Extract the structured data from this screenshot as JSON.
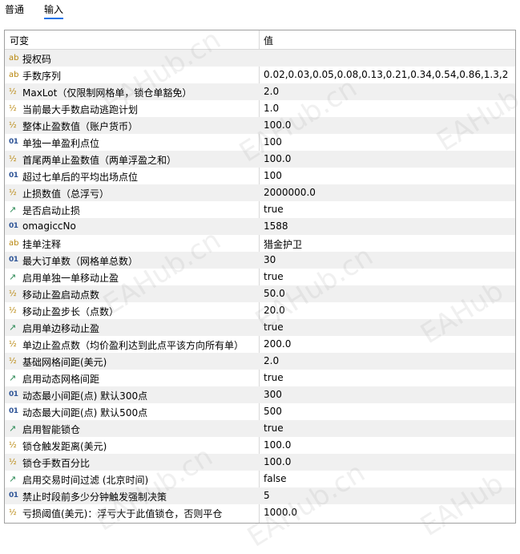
{
  "tabs": [
    {
      "label": "普通",
      "active": false
    },
    {
      "label": "输入",
      "active": true
    }
  ],
  "columns": {
    "variable": "可变",
    "value": "值"
  },
  "rows": [
    {
      "type": "string",
      "icon": "ab",
      "name": "授权码",
      "value": ""
    },
    {
      "type": "string",
      "icon": "ab",
      "name": "手数序列",
      "value": "0.02,0.03,0.05,0.08,0.13,0.21,0.34,0.54,0.86,1.3,2"
    },
    {
      "type": "double",
      "icon": "½",
      "name": "MaxLot（仅限制网格单，锁仓单豁免）",
      "value": "2.0"
    },
    {
      "type": "double",
      "icon": "½",
      "name": "当前最大手数启动逃跑计划",
      "value": "1.0"
    },
    {
      "type": "double",
      "icon": "½",
      "name": "整体止盈数值（账户货币）",
      "value": "100.0"
    },
    {
      "type": "int",
      "icon": "01",
      "name": "单独一单盈利点位",
      "value": "100"
    },
    {
      "type": "double",
      "icon": "½",
      "name": "首尾两单止盈数值（两单浮盈之和）",
      "value": "100.0"
    },
    {
      "type": "int",
      "icon": "01",
      "name": "超过七单后的平均出场点位",
      "value": "100"
    },
    {
      "type": "double",
      "icon": "½",
      "name": "止损数值（总浮亏）",
      "value": "2000000.0"
    },
    {
      "type": "bool",
      "icon": "↗",
      "name": "是否启动止损",
      "value": "true"
    },
    {
      "type": "int",
      "icon": "01",
      "name": "omagiccNo",
      "value": "1588"
    },
    {
      "type": "string",
      "icon": "ab",
      "name": "挂单注释",
      "value": "猎金护卫"
    },
    {
      "type": "int",
      "icon": "01",
      "name": "最大订单数（网格单总数）",
      "value": "30"
    },
    {
      "type": "bool",
      "icon": "↗",
      "name": "启用单独一单移动止盈",
      "value": "true"
    },
    {
      "type": "double",
      "icon": "½",
      "name": "移动止盈启动点数",
      "value": "50.0"
    },
    {
      "type": "double",
      "icon": "½",
      "name": "移动止盈步长（点数）",
      "value": "20.0"
    },
    {
      "type": "bool",
      "icon": "↗",
      "name": "启用单边移动止盈",
      "value": "true"
    },
    {
      "type": "double",
      "icon": "½",
      "name": "单边止盈点数（均价盈利达到此点平该方向所有单）",
      "value": "200.0"
    },
    {
      "type": "double",
      "icon": "½",
      "name": "基础网格间距(美元)",
      "value": "2.0"
    },
    {
      "type": "bool",
      "icon": "↗",
      "name": "启用动态网格间距",
      "value": "true"
    },
    {
      "type": "int",
      "icon": "01",
      "name": "动态最小间距(点) 默认300点",
      "value": "300"
    },
    {
      "type": "int",
      "icon": "01",
      "name": "动态最大间距(点) 默认500点",
      "value": "500"
    },
    {
      "type": "bool",
      "icon": "↗",
      "name": "启用智能锁仓",
      "value": "true"
    },
    {
      "type": "double",
      "icon": "½",
      "name": "锁仓触发距离(美元)",
      "value": "100.0"
    },
    {
      "type": "double",
      "icon": "½",
      "name": "锁仓手数百分比",
      "value": "100.0"
    },
    {
      "type": "bool",
      "icon": "↗",
      "name": "启用交易时间过滤 (北京时间)",
      "value": "false"
    },
    {
      "type": "int",
      "icon": "01",
      "name": "禁止时段前多少分钟触发强制决策",
      "value": "5"
    },
    {
      "type": "double",
      "icon": "½",
      "name": "亏损阈值(美元)：浮亏大于此值锁仓，否则平仓",
      "value": "1000.0"
    }
  ],
  "watermarks": [
    "EAHub.cn",
    "EAHub"
  ]
}
